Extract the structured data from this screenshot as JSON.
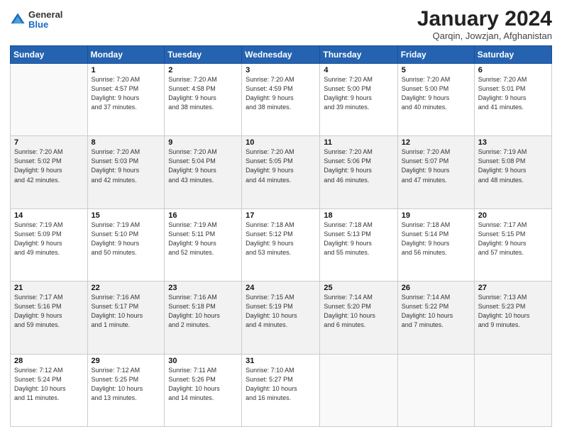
{
  "header": {
    "logo_general": "General",
    "logo_blue": "Blue",
    "title": "January 2024",
    "subtitle": "Qarqin, Jowzjan, Afghanistan"
  },
  "columns": [
    "Sunday",
    "Monday",
    "Tuesday",
    "Wednesday",
    "Thursday",
    "Friday",
    "Saturday"
  ],
  "weeks": [
    {
      "shaded": false,
      "days": [
        {
          "num": "",
          "info": ""
        },
        {
          "num": "1",
          "info": "Sunrise: 7:20 AM\nSunset: 4:57 PM\nDaylight: 9 hours\nand 37 minutes."
        },
        {
          "num": "2",
          "info": "Sunrise: 7:20 AM\nSunset: 4:58 PM\nDaylight: 9 hours\nand 38 minutes."
        },
        {
          "num": "3",
          "info": "Sunrise: 7:20 AM\nSunset: 4:59 PM\nDaylight: 9 hours\nand 38 minutes."
        },
        {
          "num": "4",
          "info": "Sunrise: 7:20 AM\nSunset: 5:00 PM\nDaylight: 9 hours\nand 39 minutes."
        },
        {
          "num": "5",
          "info": "Sunrise: 7:20 AM\nSunset: 5:00 PM\nDaylight: 9 hours\nand 40 minutes."
        },
        {
          "num": "6",
          "info": "Sunrise: 7:20 AM\nSunset: 5:01 PM\nDaylight: 9 hours\nand 41 minutes."
        }
      ]
    },
    {
      "shaded": true,
      "days": [
        {
          "num": "7",
          "info": "Sunrise: 7:20 AM\nSunset: 5:02 PM\nDaylight: 9 hours\nand 42 minutes."
        },
        {
          "num": "8",
          "info": "Sunrise: 7:20 AM\nSunset: 5:03 PM\nDaylight: 9 hours\nand 42 minutes."
        },
        {
          "num": "9",
          "info": "Sunrise: 7:20 AM\nSunset: 5:04 PM\nDaylight: 9 hours\nand 43 minutes."
        },
        {
          "num": "10",
          "info": "Sunrise: 7:20 AM\nSunset: 5:05 PM\nDaylight: 9 hours\nand 44 minutes."
        },
        {
          "num": "11",
          "info": "Sunrise: 7:20 AM\nSunset: 5:06 PM\nDaylight: 9 hours\nand 46 minutes."
        },
        {
          "num": "12",
          "info": "Sunrise: 7:20 AM\nSunset: 5:07 PM\nDaylight: 9 hours\nand 47 minutes."
        },
        {
          "num": "13",
          "info": "Sunrise: 7:19 AM\nSunset: 5:08 PM\nDaylight: 9 hours\nand 48 minutes."
        }
      ]
    },
    {
      "shaded": false,
      "days": [
        {
          "num": "14",
          "info": "Sunrise: 7:19 AM\nSunset: 5:09 PM\nDaylight: 9 hours\nand 49 minutes."
        },
        {
          "num": "15",
          "info": "Sunrise: 7:19 AM\nSunset: 5:10 PM\nDaylight: 9 hours\nand 50 minutes."
        },
        {
          "num": "16",
          "info": "Sunrise: 7:19 AM\nSunset: 5:11 PM\nDaylight: 9 hours\nand 52 minutes."
        },
        {
          "num": "17",
          "info": "Sunrise: 7:18 AM\nSunset: 5:12 PM\nDaylight: 9 hours\nand 53 minutes."
        },
        {
          "num": "18",
          "info": "Sunrise: 7:18 AM\nSunset: 5:13 PM\nDaylight: 9 hours\nand 55 minutes."
        },
        {
          "num": "19",
          "info": "Sunrise: 7:18 AM\nSunset: 5:14 PM\nDaylight: 9 hours\nand 56 minutes."
        },
        {
          "num": "20",
          "info": "Sunrise: 7:17 AM\nSunset: 5:15 PM\nDaylight: 9 hours\nand 57 minutes."
        }
      ]
    },
    {
      "shaded": true,
      "days": [
        {
          "num": "21",
          "info": "Sunrise: 7:17 AM\nSunset: 5:16 PM\nDaylight: 9 hours\nand 59 minutes."
        },
        {
          "num": "22",
          "info": "Sunrise: 7:16 AM\nSunset: 5:17 PM\nDaylight: 10 hours\nand 1 minute."
        },
        {
          "num": "23",
          "info": "Sunrise: 7:16 AM\nSunset: 5:18 PM\nDaylight: 10 hours\nand 2 minutes."
        },
        {
          "num": "24",
          "info": "Sunrise: 7:15 AM\nSunset: 5:19 PM\nDaylight: 10 hours\nand 4 minutes."
        },
        {
          "num": "25",
          "info": "Sunrise: 7:14 AM\nSunset: 5:20 PM\nDaylight: 10 hours\nand 6 minutes."
        },
        {
          "num": "26",
          "info": "Sunrise: 7:14 AM\nSunset: 5:22 PM\nDaylight: 10 hours\nand 7 minutes."
        },
        {
          "num": "27",
          "info": "Sunrise: 7:13 AM\nSunset: 5:23 PM\nDaylight: 10 hours\nand 9 minutes."
        }
      ]
    },
    {
      "shaded": false,
      "days": [
        {
          "num": "28",
          "info": "Sunrise: 7:12 AM\nSunset: 5:24 PM\nDaylight: 10 hours\nand 11 minutes."
        },
        {
          "num": "29",
          "info": "Sunrise: 7:12 AM\nSunset: 5:25 PM\nDaylight: 10 hours\nand 13 minutes."
        },
        {
          "num": "30",
          "info": "Sunrise: 7:11 AM\nSunset: 5:26 PM\nDaylight: 10 hours\nand 14 minutes."
        },
        {
          "num": "31",
          "info": "Sunrise: 7:10 AM\nSunset: 5:27 PM\nDaylight: 10 hours\nand 16 minutes."
        },
        {
          "num": "",
          "info": ""
        },
        {
          "num": "",
          "info": ""
        },
        {
          "num": "",
          "info": ""
        }
      ]
    }
  ]
}
